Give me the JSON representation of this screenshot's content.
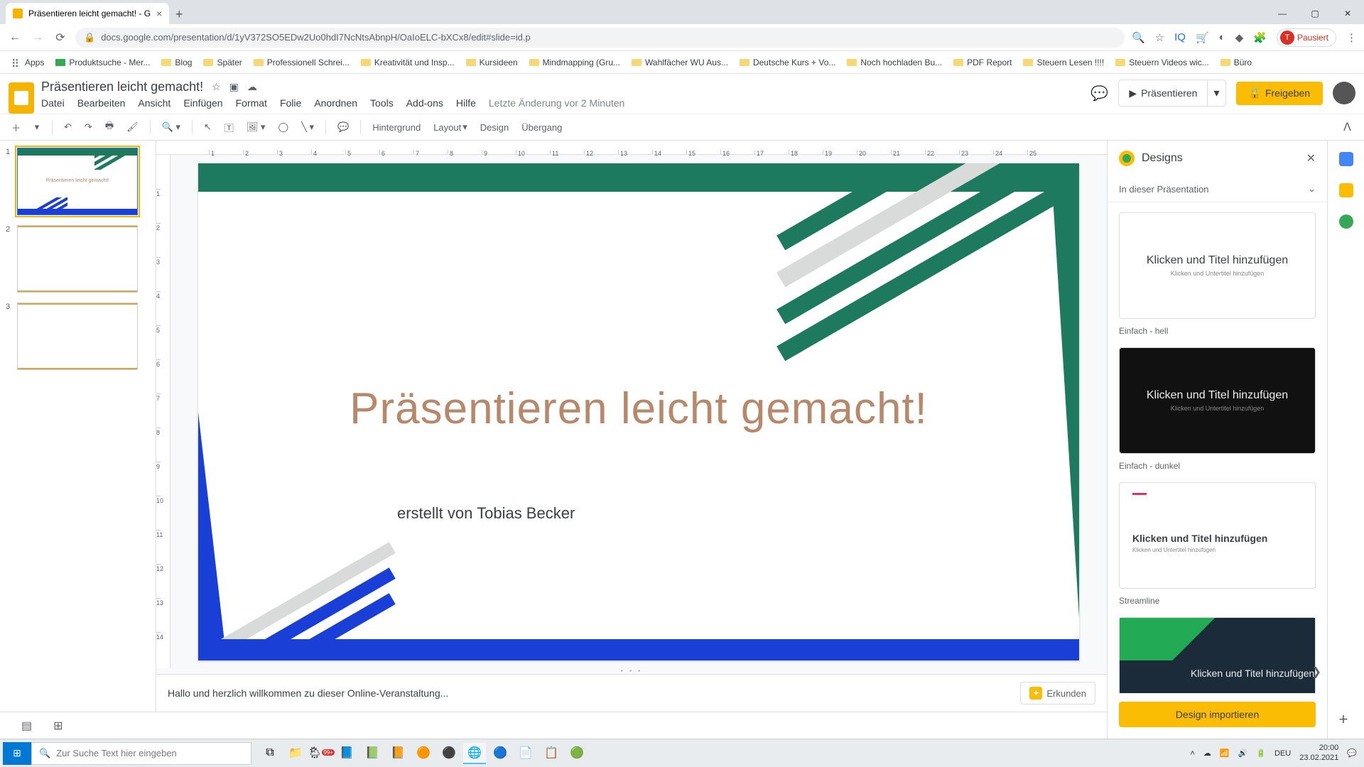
{
  "browser": {
    "tab_title": "Präsentieren leicht gemacht! - G",
    "url": "docs.google.com/presentation/d/1yV372SO5EDw2Uo0hdI7NcNtsAbnpH/OaIoELC-bXCx8/edit#slide=id.p",
    "paused_label": "Pausiert",
    "paused_initial": "T"
  },
  "bookmarks": [
    "Apps",
    "Produktsuche - Mer...",
    "Blog",
    "Später",
    "Professionell Schrei...",
    "Kreativität und Insp...",
    "Kursideen",
    "Mindmapping (Gru...",
    "Wahlfächer WU Aus...",
    "Deutsche Kurs + Vo...",
    "Noch hochladen Bu...",
    "PDF Report",
    "Steuern Lesen !!!!",
    "Steuern Videos wic...",
    "Büro"
  ],
  "doc": {
    "title": "Präsentieren leicht gemacht!",
    "menus": [
      "Datei",
      "Bearbeiten",
      "Ansicht",
      "Einfügen",
      "Format",
      "Folie",
      "Anordnen",
      "Tools",
      "Add-ons",
      "Hilfe"
    ],
    "last_edit": "Letzte Änderung vor 2 Minuten",
    "present": "Präsentieren",
    "share": "Freigeben"
  },
  "toolbar": {
    "hintergrund": "Hintergrund",
    "layout": "Layout",
    "design": "Design",
    "uebergang": "Übergang"
  },
  "ruler_h": [
    1,
    2,
    3,
    4,
    5,
    6,
    7,
    8,
    9,
    10,
    11,
    12,
    13,
    14,
    15,
    16,
    17,
    18,
    19,
    20,
    21,
    22,
    23,
    24,
    25
  ],
  "ruler_v": [
    1,
    2,
    3,
    4,
    5,
    6,
    7,
    8,
    9,
    10,
    11,
    12,
    13,
    14
  ],
  "slides": {
    "numbers": [
      "1",
      "2",
      "3"
    ],
    "thumb_title": "Präsentieren leicht gemacht!"
  },
  "slide_content": {
    "title": "Präsentieren leicht gemacht!",
    "subtitle": "erstellt von Tobias Becker"
  },
  "notes": {
    "text": "Hallo und herzlich willkommen zu dieser Online-Veranstaltung...",
    "erkunden": "Erkunden"
  },
  "designs": {
    "title": "Designs",
    "section": "In dieser Präsentation",
    "card_title": "Klicken und Titel hinzufügen",
    "card_sub": "Klicken und Untertitel hinzufügen",
    "cap_light": "Einfach - hell",
    "cap_dark": "Einfach - dunkel",
    "cap_stream": "Streamline",
    "import": "Design importieren"
  },
  "taskbar": {
    "search_placeholder": "Zur Suche Text hier eingeben",
    "lang": "DEU",
    "time": "20:00",
    "date": "23.02.2021",
    "weather_badge": "99+"
  }
}
